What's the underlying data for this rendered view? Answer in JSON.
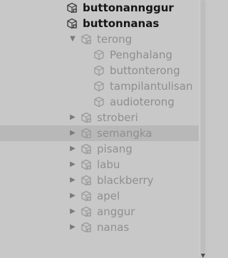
{
  "tree": {
    "items": [
      {
        "label": "buttonannggur",
        "kind": "prefab-plus",
        "state": "active",
        "arrow": "none",
        "depth": 0
      },
      {
        "label": "buttonnanas",
        "kind": "prefab-plus",
        "state": "active",
        "arrow": "none",
        "depth": 0
      },
      {
        "label": "terong",
        "kind": "prefab-plus",
        "state": "inactive",
        "arrow": "expanded",
        "depth": 1
      },
      {
        "label": "Penghalang",
        "kind": "prefab",
        "state": "inactive-child",
        "arrow": "none",
        "depth": 2
      },
      {
        "label": "buttonterong",
        "kind": "prefab",
        "state": "inactive-child",
        "arrow": "none",
        "depth": 2
      },
      {
        "label": "tampilantulisan",
        "kind": "prefab",
        "state": "inactive-child",
        "arrow": "none",
        "depth": 2
      },
      {
        "label": "audioterong",
        "kind": "prefab",
        "state": "inactive-child",
        "arrow": "none",
        "depth": 2
      },
      {
        "label": "stroberi",
        "kind": "prefab-plus",
        "state": "inactive",
        "arrow": "collapsed",
        "depth": 1
      },
      {
        "label": "semangka",
        "kind": "prefab-plus",
        "state": "inactive",
        "arrow": "collapsed",
        "depth": 1,
        "selected": true
      },
      {
        "label": "pisang",
        "kind": "prefab-plus",
        "state": "inactive",
        "arrow": "collapsed",
        "depth": 1
      },
      {
        "label": "labu",
        "kind": "prefab-plus",
        "state": "inactive",
        "arrow": "collapsed",
        "depth": 1
      },
      {
        "label": "blackberry",
        "kind": "prefab-plus",
        "state": "inactive",
        "arrow": "collapsed",
        "depth": 1
      },
      {
        "label": "apel",
        "kind": "prefab-plus",
        "state": "inactive",
        "arrow": "collapsed",
        "depth": 1
      },
      {
        "label": "anggur",
        "kind": "prefab-plus",
        "state": "inactive",
        "arrow": "collapsed",
        "depth": 1
      },
      {
        "label": "nanas",
        "kind": "prefab-plus",
        "state": "inactive",
        "arrow": "collapsed",
        "depth": 1
      }
    ]
  },
  "icons": {
    "expanded_arrow": "▼",
    "collapsed_arrow": "▶",
    "scroll_down_arrow": "▼"
  },
  "colors": {
    "background": "#c8c8c8",
    "selected_row": "#b8b8b8",
    "active_text": "#151515",
    "inactive_text": "#8f8f8f",
    "icon_gray": "#9a9a9a",
    "icon_dark": "#4a4a4a"
  }
}
